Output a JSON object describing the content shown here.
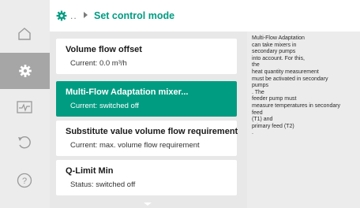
{
  "header": {
    "icon": "gear-icon",
    "breadcrumb_dots": "..",
    "title": "Set control mode"
  },
  "sidebar": {
    "items": [
      {
        "icon": "home-icon",
        "active": false
      },
      {
        "icon": "gear-icon",
        "active": true
      },
      {
        "icon": "diagnostics-icon",
        "active": false
      },
      {
        "icon": "restore-icon",
        "active": false
      },
      {
        "icon": "help-icon",
        "active": false
      }
    ]
  },
  "menu": {
    "items": [
      {
        "title": "Volume flow offset",
        "sub": "Current: 0.0 m³/h",
        "selected": false
      },
      {
        "title": "Multi-Flow Adaptation mixer...",
        "sub": "Current: switched off",
        "selected": true
      },
      {
        "title": "Substitute value volume flow requirement",
        "sub": "Current: max. volume flow requirement",
        "selected": false
      },
      {
        "title": "Q-Limit Min",
        "sub": "Status: switched off",
        "selected": false
      }
    ]
  },
  "info": {
    "text": "Multi-Flow Adaptation\ncan take mixers in\nsecondary pumps\ninto account. For this,\nthe\nheat quantity measurement\nmust be activated in secondary\npumps\n. The\nfeeder pump must\nmeasure temperatures in secondary\nfeed\n(T1) and\nprimary feed (T2)\n."
  },
  "colors": {
    "accent": "#009c82",
    "sidebar": "#ececec",
    "sidebar_active": "#a6a6a6",
    "content_bg": "#e8e8e8"
  }
}
